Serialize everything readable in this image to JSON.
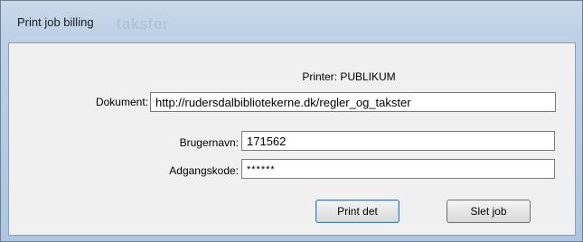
{
  "window": {
    "title": "Print job billing",
    "ghost_title": "takster"
  },
  "form": {
    "printer_line": "Printer: PUBLIKUM",
    "document_label": "Dokument:",
    "document_value": "http://rudersdalbibliotekerne.dk/regler_og_takster",
    "username_label": "Brugernavn:",
    "username_value": "171562",
    "password_label": "Adgangskode:",
    "password_value": "******"
  },
  "buttons": {
    "print_label": "Print det",
    "delete_label": "Slet job"
  }
}
